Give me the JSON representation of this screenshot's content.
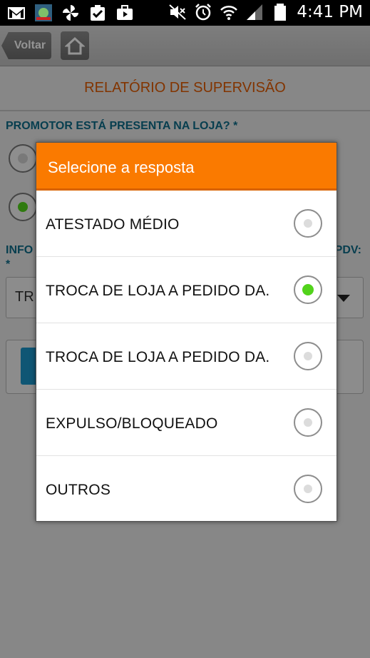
{
  "status_bar": {
    "time": "4:41 PM",
    "left_icons": [
      "gmail-icon",
      "app-thumbnail-icon",
      "pinwheel-icon",
      "clipboard-check-icon",
      "briefcase-play-icon"
    ],
    "right_icons": [
      "mute-icon",
      "alarm-icon",
      "wifi-icon",
      "signal-icon",
      "battery-icon"
    ]
  },
  "app": {
    "back_label": "Voltar",
    "title": "RELATÓRIO DE SUPERVISÃO",
    "question1": "PROMOTOR ESTÁ PRESENTA NA LOJA? *",
    "question2_start": "INFO",
    "question2_end": "PDV:",
    "question2_star": "*",
    "select_value_partial": "TR"
  },
  "dialog": {
    "title": "Selecione a resposta",
    "options": [
      {
        "label": "ATESTADO MÉDIO",
        "selected": false
      },
      {
        "label": "TROCA DE LOJA A PEDIDO DA.",
        "selected": true
      },
      {
        "label": "TROCA DE LOJA A PEDIDO DA.",
        "selected": false
      },
      {
        "label": "EXPULSO/BLOQUEADO",
        "selected": false
      },
      {
        "label": "OUTROS",
        "selected": false
      }
    ]
  },
  "colors": {
    "accent": "#fa7a00",
    "title": "#e05a00",
    "label": "#0d6c88",
    "radio_selected": "#52d31b"
  }
}
